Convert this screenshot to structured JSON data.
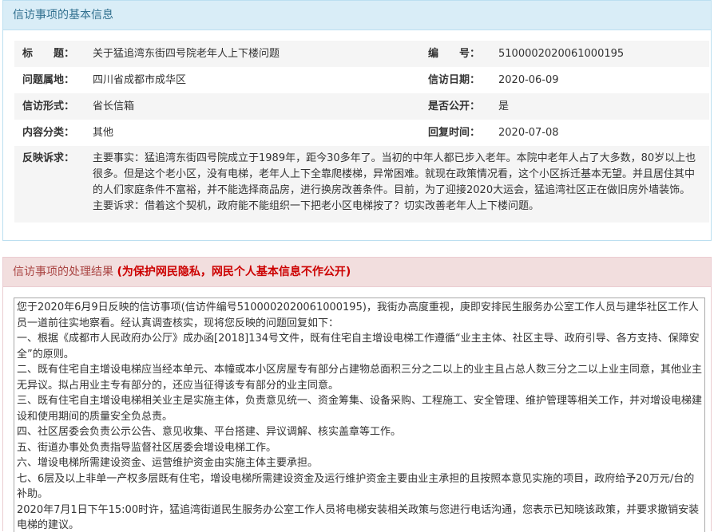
{
  "basic_info": {
    "header": "信访事项的基本信息",
    "rows": [
      {
        "l1": "标　　题：",
        "v1": "关于猛追湾东街四号院老年人上下楼问题",
        "l2": "编　　号：",
        "v2": "5100002020061000195"
      },
      {
        "l1": "问题属地：",
        "v1": "四川省成都市成华区",
        "l2": "信访日期：",
        "v2": "2020-06-09"
      },
      {
        "l1": "信访形式：",
        "v1": "省长信箱",
        "l2": "是否公开：",
        "v2": "是"
      },
      {
        "l1": "内容分类：",
        "v1": "其他",
        "l2": "回复时间：",
        "v2": "2020-07-08"
      }
    ],
    "appeal_label": "反映诉求：",
    "appeal_text": "主要事实：猛追湾东街四号院成立于1989年，距今30多年了。当初的中年人都已步入老年。本院中老年人占了大多数，80岁以上也很多。但是这个老小区，没有电梯，老年人上下全靠爬楼梯，异常困难。就现在政策情况看，这个小区拆迁基本无望。并且居住其中的人们家庭条件不富裕，并不能选择商品房，进行换房改善条件。目前，为了迎接2020大运会，猛追湾社区正在做旧房外墙装饰。 主要诉求：借着这个契机，政府能不能组织一下把老小区电梯按了？切实改善老年人上下楼问题。"
  },
  "result": {
    "header": "信访事项的处理结果",
    "note": "(为保护网民隐私，网民个人基本信息不作公开)",
    "text": "您于2020年6月9日反映的信访事项(信访件编号5100002020061000195)，我街办高度重视，庚即安排民生服务办公室工作人员与建华社区工作人员一道前往实地察看。经认真调查核实，现将您反映的问题回复如下：\n一、根据《成都市人民政府办公厅》成办函[2018]134号文件，既有住宅自主增设电梯工作遵循“业主主体、社区主导、政府引导、各方支持、保障安全”的原则。\n二、既有住宅自主增设电梯应当经本单元、本幢或本小区房屋专有部分占建物总面积三分之二以上的业主且占总人数三分之二以上业主同意，其他业主无异议。拟占用业主专有部分的，还应当征得该专有部分的业主同意。\n三、既有住宅自主增设电梯相关业主是实施主体，负责意见统一、资金筹集、设备采购、工程施工、安全管理、维护管理等相关工作，并对增设电梯建设和使用期间的质量安全负总责。\n四、社区居委会负责公示公告、意见收集、平台搭建、异议调解、核实盖章等工作。\n五、街道办事处负责指导监督社区居委会增设电梯工作。\n六、增设电梯所需建设资金、运营维护资金由实施主体主要承担。\n七、6层及以上非单一产权多层既有住宅，增设电梯所需建设资金及运行维护资金主要由业主承担的且按照本意见实施的项目，政府给予20万元/台的补助。\n2020年7月1日下午15:00时许，猛追湾街道民生服务办公室工作人员将电梯安装相关政策与您进行电话沟通，您表示已知晓该政策，并要求撤销安装电梯的建议。"
  }
}
